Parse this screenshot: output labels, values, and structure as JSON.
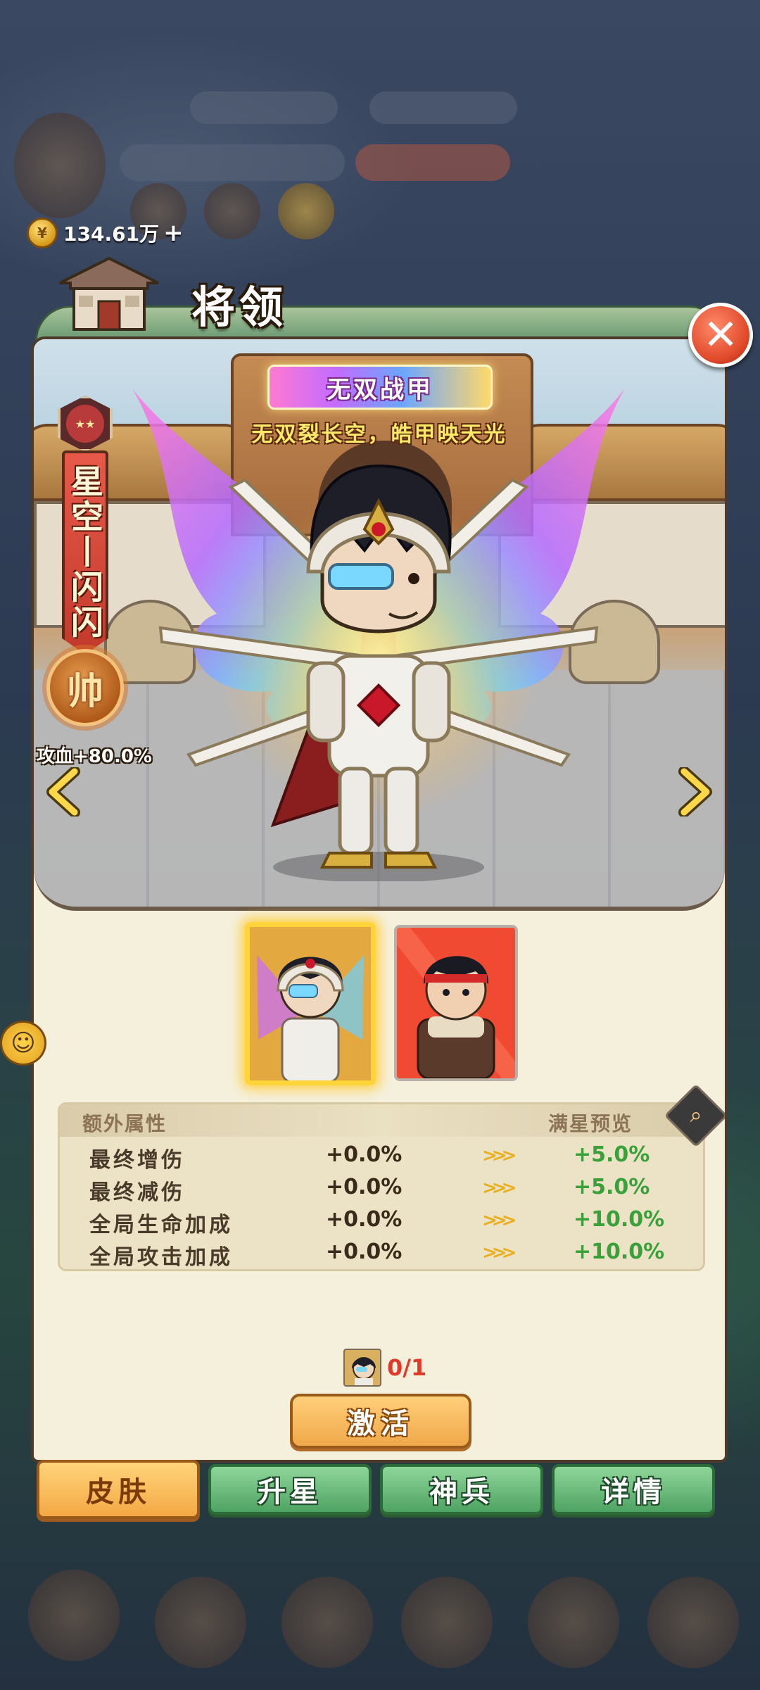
{
  "currency": {
    "amount": "134.61万",
    "plus": "+",
    "coin_glyph": "¥"
  },
  "header": {
    "title": "将领"
  },
  "close": {
    "glyph": "✕"
  },
  "skin": {
    "name": "无双战甲",
    "motto": "无双裂长空，皓甲映天光"
  },
  "hero": {
    "name": "星空丨闪闪",
    "stars_glyph": "★★",
    "rank": "帅",
    "bonus": "攻血+80.0%"
  },
  "navigation": {
    "prev_glyph": "‹",
    "next_glyph": "›"
  },
  "attributes": {
    "title": "额外属性",
    "preview_label": "满星预览",
    "arrow_glyph": ">>>",
    "rows": [
      {
        "name": "最终增伤",
        "current": "+0.0%",
        "max": "+5.0%"
      },
      {
        "name": "最终减伤",
        "current": "+0.0%",
        "max": "+5.0%"
      },
      {
        "name": "全局生命加成",
        "current": "+0.0%",
        "max": "+10.0%"
      },
      {
        "name": "全局攻击加成",
        "current": "+0.0%",
        "max": "+10.0%"
      }
    ]
  },
  "cost": {
    "count": "0/1"
  },
  "activate": {
    "label": "激活"
  },
  "tabs": [
    {
      "label": "皮肤",
      "active": true
    },
    {
      "label": "升星",
      "active": false
    },
    {
      "label": "神兵",
      "active": false
    },
    {
      "label": "详情",
      "active": false
    }
  ],
  "colors": {
    "panel_bg": "#f5f0dc",
    "tab_active": "#f4a844",
    "tab_inactive": "#4fa362",
    "max_value_green": "#3aa03a",
    "cost_red": "#e23a2a"
  }
}
